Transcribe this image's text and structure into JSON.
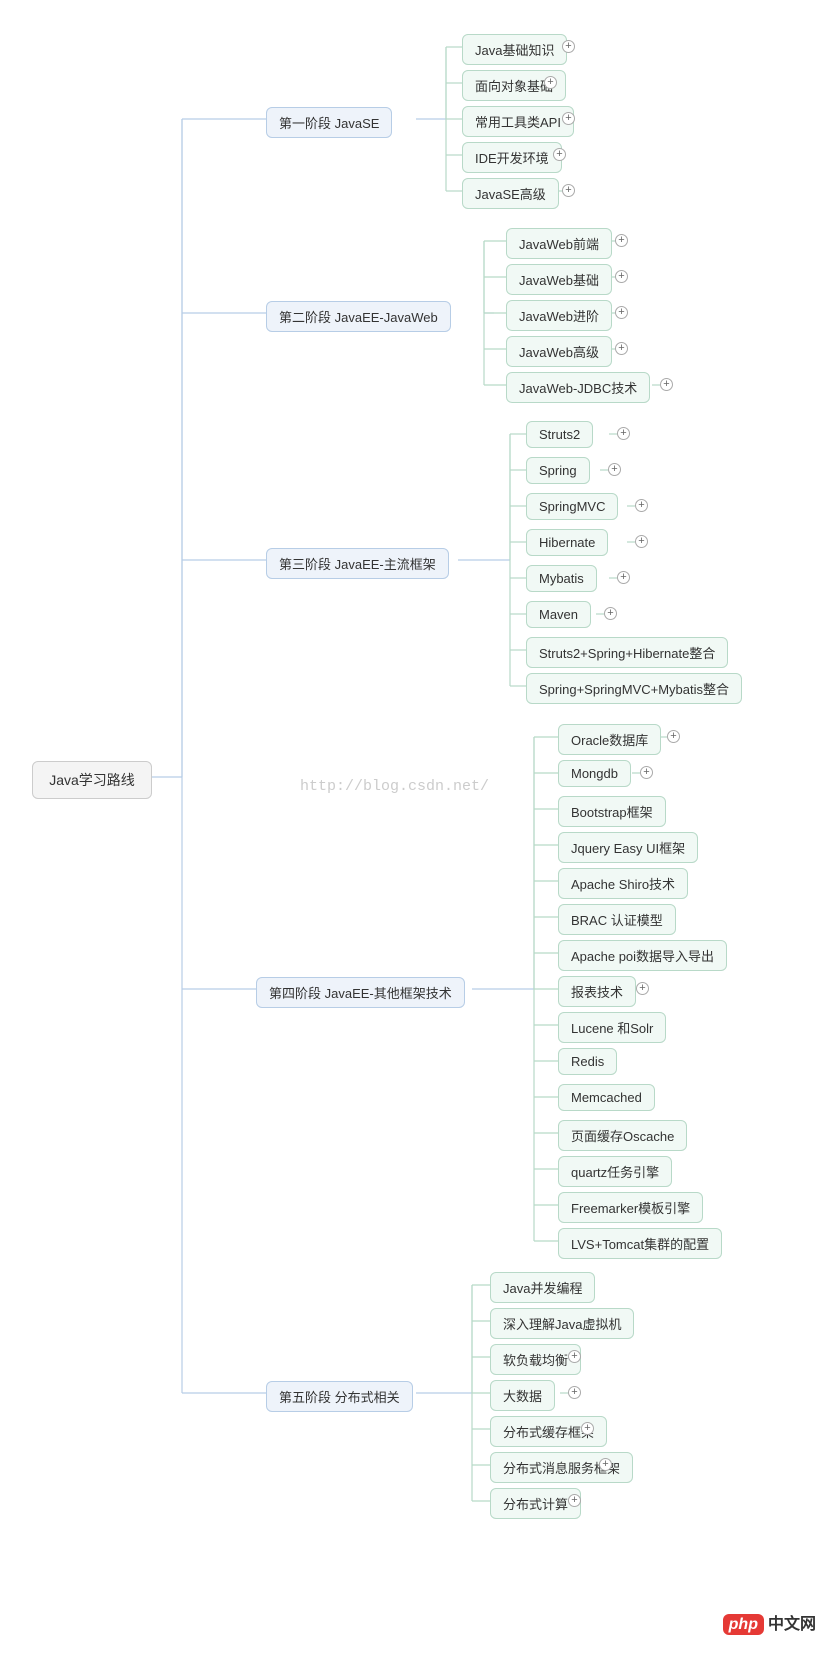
{
  "root": {
    "label": "Java学习路线"
  },
  "watermark": "http://blog.csdn.net/",
  "footer": {
    "php": "php",
    "cn": "中文网"
  },
  "phases": [
    {
      "label": "第一阶段 JavaSE",
      "children": [
        {
          "label": "Java基础知识",
          "expandable": true
        },
        {
          "label": "面向对象基础",
          "expandable": true
        },
        {
          "label": "常用工具类API",
          "expandable": true
        },
        {
          "label": "IDE开发环境",
          "expandable": true
        },
        {
          "label": "JavaSE高级",
          "expandable": true
        }
      ]
    },
    {
      "label": "第二阶段 JavaEE-JavaWeb",
      "children": [
        {
          "label": "JavaWeb前端",
          "expandable": true
        },
        {
          "label": "JavaWeb基础",
          "expandable": true
        },
        {
          "label": "JavaWeb进阶",
          "expandable": true
        },
        {
          "label": "JavaWeb高级",
          "expandable": true
        },
        {
          "label": "JavaWeb-JDBC技术",
          "expandable": true
        }
      ]
    },
    {
      "label": "第三阶段 JavaEE-主流框架",
      "children": [
        {
          "label": "Struts2",
          "expandable": true
        },
        {
          "label": "Spring",
          "expandable": true
        },
        {
          "label": "SpringMVC",
          "expandable": true
        },
        {
          "label": "Hibernate",
          "expandable": true
        },
        {
          "label": "Mybatis",
          "expandable": true
        },
        {
          "label": "Maven",
          "expandable": true
        },
        {
          "label": "Struts2+Spring+Hibernate整合",
          "expandable": false
        },
        {
          "label": "Spring+SpringMVC+Mybatis整合",
          "expandable": false
        }
      ]
    },
    {
      "label": "第四阶段 JavaEE-其他框架技术",
      "children": [
        {
          "label": "Oracle数据库",
          "expandable": true
        },
        {
          "label": "Mongdb",
          "expandable": true
        },
        {
          "label": "Bootstrap框架",
          "expandable": false
        },
        {
          "label": "Jquery Easy UI框架",
          "expandable": false
        },
        {
          "label": "Apache Shiro技术",
          "expandable": false
        },
        {
          "label": "BRAC 认证模型",
          "expandable": false
        },
        {
          "label": "Apache poi数据导入导出",
          "expandable": false
        },
        {
          "label": "报表技术",
          "expandable": true
        },
        {
          "label": "Lucene 和Solr",
          "expandable": false
        },
        {
          "label": "Redis",
          "expandable": false
        },
        {
          "label": "Memcached",
          "expandable": false
        },
        {
          "label": "页面缓存Oscache",
          "expandable": false
        },
        {
          "label": "quartz任务引擎",
          "expandable": false
        },
        {
          "label": "Freemarker模板引擎",
          "expandable": false
        },
        {
          "label": "LVS+Tomcat集群的配置",
          "expandable": false
        }
      ]
    },
    {
      "label": "第五阶段 分布式相关",
      "children": [
        {
          "label": "Java并发编程",
          "expandable": false
        },
        {
          "label": "深入理解Java虚拟机",
          "expandable": false
        },
        {
          "label": "软负载均衡",
          "expandable": true
        },
        {
          "label": "大数据",
          "expandable": true
        },
        {
          "label": "分布式缓存框架",
          "expandable": true
        },
        {
          "label": "分布式消息服务框架",
          "expandable": true
        },
        {
          "label": "分布式计算",
          "expandable": true
        }
      ]
    }
  ]
}
